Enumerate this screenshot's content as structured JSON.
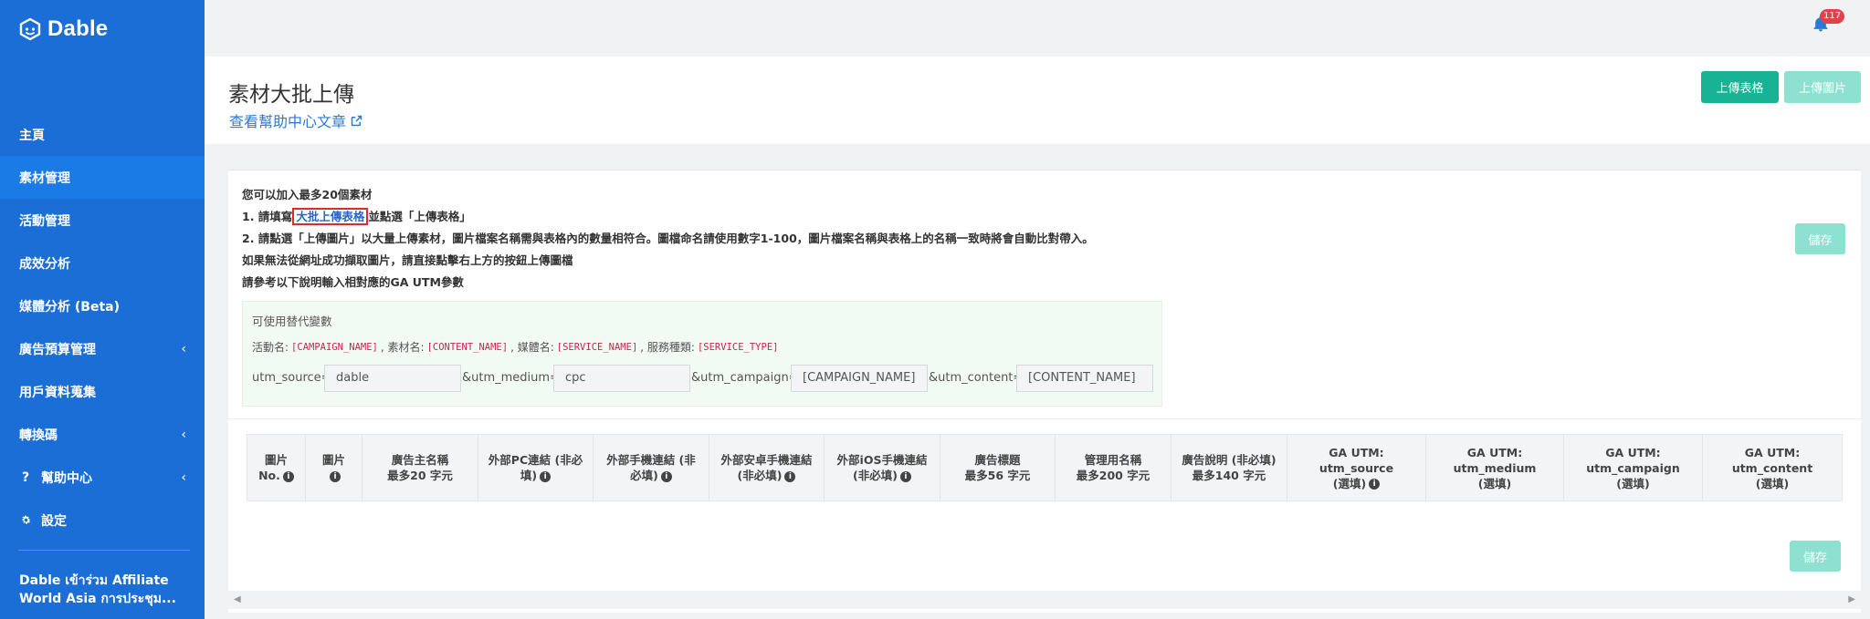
{
  "app": {
    "logo_text": "Dable"
  },
  "sidebar": {
    "items": [
      {
        "label": "主頁"
      },
      {
        "label": "素材管理"
      },
      {
        "label": "活動管理"
      },
      {
        "label": "成效分析"
      },
      {
        "label": "媒體分析 (Beta)"
      },
      {
        "label": "廣告預算管理"
      },
      {
        "label": "用戶資料蒐集"
      },
      {
        "label": "轉換碼"
      },
      {
        "label": "幫助中心"
      },
      {
        "label": "設定"
      }
    ],
    "news_line1": "Dable เข้าร่วม Affiliate",
    "news_line2": "World Asia การประชุม..."
  },
  "topbar": {
    "notification_count": "117"
  },
  "header": {
    "title": "素材大批上傳",
    "help_link": "查看幫助中心文章",
    "upload_sheet_button": "上傳表格",
    "upload_image_button": "上傳圖片"
  },
  "instructions": {
    "line1": "您可以加入最多20個素材",
    "line2_prefix": "1. 請填寫",
    "line2_link": "大批上傳表格",
    "line2_suffix": "並點選「上傳表格」",
    "line3": "2. 請點選「上傳圖片」以大量上傳素材，圖片檔案名稱需與表格內的數量相符合。圖檔命名請使用數字1-100，圖片檔案名稱與表格上的名稱一致時將會自動比對帶入。",
    "line4": "如果無法從網址成功擷取圖片，請直接點擊右上方的按鈕上傳圖檔",
    "line5": "請參考以下說明輸入相對應的GA UTM參數",
    "save_button": "儲存"
  },
  "variables": {
    "title": "可使用替代變數",
    "campaign_label": "活動名:",
    "campaign_code": "[CAMPAIGN_NAME]",
    "content_label": ", 素材名:",
    "content_code": "[CONTENT_NAME]",
    "service_label": ", 媒體名:",
    "service_code": "[SERVICE_NAME]",
    "type_label": ", 服務種類:",
    "type_code": "[SERVICE_TYPE]"
  },
  "utm": {
    "source_label": "utm_source=",
    "source_value": "dable",
    "medium_label": "&utm_medium=",
    "medium_value": "cpc",
    "campaign_label": "&utm_campaign=",
    "campaign_value": "[CAMPAIGN_NAME]",
    "content_label": "&utm_content=",
    "content_value": "[CONTENT_NAME]"
  },
  "table": {
    "columns": [
      {
        "line1": "圖片",
        "line2": "No."
      },
      {
        "line1": "圖片",
        "line2": ""
      },
      {
        "line1": "廣告主名稱",
        "line2": "最多20 字元"
      },
      {
        "line1": "外部PC連結 (非必",
        "line2": "填)"
      },
      {
        "line1": "外部手機連結 (非",
        "line2": "必填)"
      },
      {
        "line1": "外部安卓手機連結",
        "line2": "(非必填)"
      },
      {
        "line1": "外部iOS手機連結",
        "line2": "(非必填)"
      },
      {
        "line1": "廣告標題",
        "line2": "最多56 字元"
      },
      {
        "line1": "管理用名稱",
        "line2": "最多200 字元"
      },
      {
        "line1": "廣告說明 (非必填)",
        "line2": "最多140 字元"
      },
      {
        "line1": "GA UTM:",
        "line2": "utm_source",
        "line3": "(選填)"
      },
      {
        "line1": "GA UTM:",
        "line2": "utm_medium",
        "line3": "(選填)"
      },
      {
        "line1": "GA UTM:",
        "line2": "utm_campaign",
        "line3": "(選填)"
      },
      {
        "line1": "GA UTM:",
        "line2": "utm_content",
        "line3": "(選填)"
      }
    ],
    "save_button": "儲存"
  },
  "colors": {
    "sidebar": "#1b6ed6",
    "sidebar_active": "#1a7ae6",
    "primary_button": "#18b394",
    "disabled_button": "#8ee0d0",
    "link": "#2a7ad9",
    "badge": "#e0434b"
  }
}
